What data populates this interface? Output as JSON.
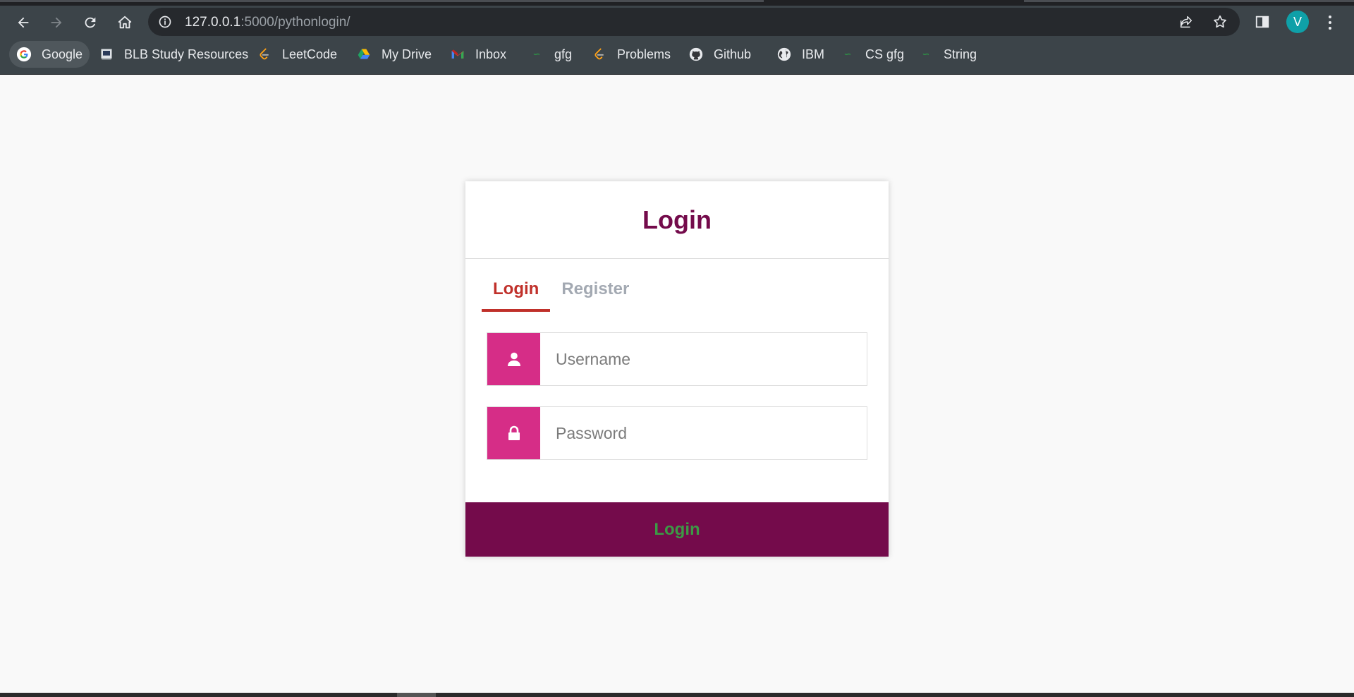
{
  "browser": {
    "url_host": "127.0.0.1",
    "url_path": ":5000/pythonlogin/",
    "avatar_letter": "V",
    "bookmarks": [
      {
        "label": "Google",
        "icon": "google-icon"
      },
      {
        "label": "BLB Study Resources",
        "icon": "blb-icon"
      },
      {
        "label": "LeetCode",
        "icon": "leetcode-icon"
      },
      {
        "label": "My Drive",
        "icon": "drive-icon"
      },
      {
        "label": "Inbox",
        "icon": "gmail-icon"
      },
      {
        "label": "gfg",
        "icon": "gfg-icon"
      },
      {
        "label": "Problems",
        "icon": "leetcode-icon"
      },
      {
        "label": "Github",
        "icon": "github-icon"
      },
      {
        "label": "IBM",
        "icon": "globe-icon"
      },
      {
        "label": "CS gfg",
        "icon": "gfg-icon"
      },
      {
        "label": "String",
        "icon": "gfg-icon"
      }
    ]
  },
  "login": {
    "title": "Login",
    "tabs": [
      {
        "label": "Login",
        "active": true
      },
      {
        "label": "Register",
        "active": false
      }
    ],
    "username_placeholder": "Username",
    "password_placeholder": "Password",
    "submit_label": "Login"
  },
  "colors": {
    "primary": "#740b4b",
    "accent": "#d62d87",
    "tab_active": "#c0302a",
    "submit_text": "#3c9a45"
  }
}
